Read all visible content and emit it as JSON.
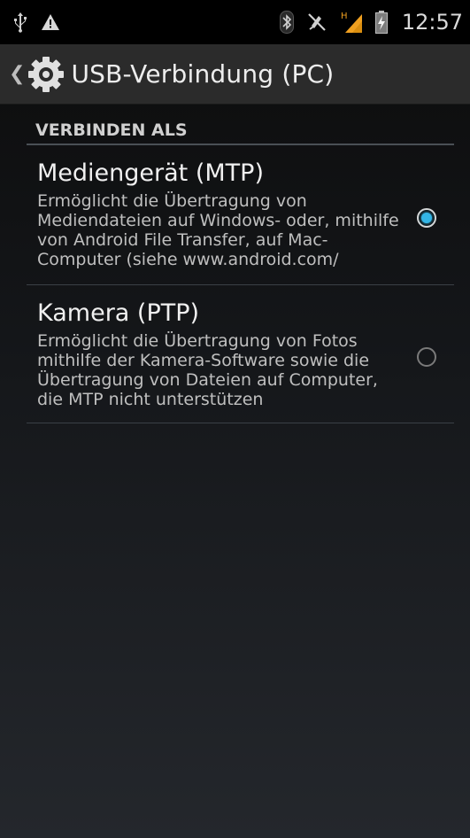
{
  "status_bar": {
    "left_icons": [
      "usb-icon",
      "warning-icon"
    ],
    "right_icons": [
      "bluetooth-icon",
      "silent-mode-icon",
      "signal-icon",
      "battery-charging-icon"
    ],
    "signal_label": "H",
    "time": "12:57"
  },
  "action_bar": {
    "title": "USB-Verbindung (PC)",
    "up_icon": "back-caret-icon",
    "app_icon": "settings-gear-icon"
  },
  "section": {
    "header": "VERBINDEN ALS"
  },
  "options": [
    {
      "title": "Mediengerät (MTP)",
      "summary": "Ermöglicht die Übertragung von Mediendateien auf Windows- oder, mithilfe von Android File Transfer, auf Mac-Computer (siehe www.android.com/",
      "selected": true
    },
    {
      "title": "Kamera (PTP)",
      "summary": "Ermöglicht die Übertragung von Fotos mithilfe der Kamera-Software sowie die Übertragung von Dateien auf Computer, die MTP nicht unterstützen",
      "selected": false
    }
  ],
  "colors": {
    "accent": "#33b5e5",
    "signal": "#f0a020"
  }
}
